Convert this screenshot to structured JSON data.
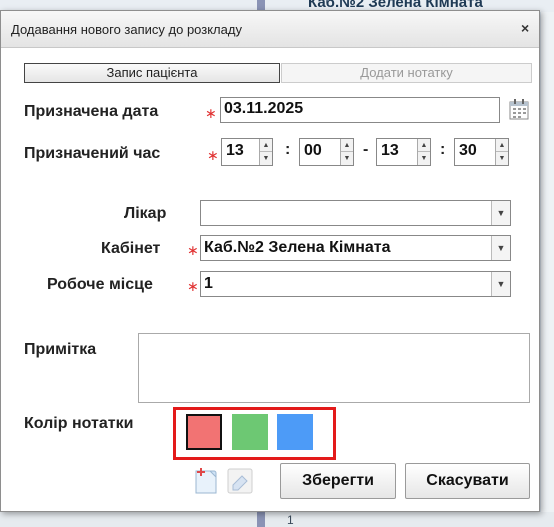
{
  "background": {
    "top_text": "Каб.№2 Зелена Кімната",
    "bottom_text": "1"
  },
  "dialog": {
    "title": "Додавання нового запису до розкладу",
    "close_label": "×"
  },
  "tabs": [
    {
      "label": "Запис пацієнта",
      "active": true
    },
    {
      "label": "Додати нотатку",
      "active": false
    }
  ],
  "form": {
    "date_label": "Призначена дата",
    "date_value": "03.11.2025",
    "time_label": "Призначений час",
    "time_start_hour": "13",
    "time_start_min": "00",
    "time_end_hour": "13",
    "time_end_min": "30",
    "time_colon": ":",
    "time_dash": "-",
    "required_mark": "∗",
    "doctor_label": "Лікар",
    "doctor_value": "",
    "cabinet_label": "Кабінет",
    "cabinet_value": "Каб.№2 Зелена Кімната",
    "workplace_label": "Робоче місце",
    "workplace_value": "1",
    "note_label": "Примітка",
    "note_value": "",
    "color_label": "Колір нотатки"
  },
  "swatches": [
    {
      "name": "red",
      "color": "#f27373",
      "selected": true
    },
    {
      "name": "green",
      "color": "#6dc873",
      "selected": false
    },
    {
      "name": "blue",
      "color": "#4d9bf7",
      "selected": false
    }
  ],
  "buttons": {
    "save": "Зберегти",
    "cancel": "Скасувати"
  },
  "icons": {
    "calendar": "calendar-icon",
    "dropdown": "chevron-down-icon",
    "spinner_up": "triangle-up",
    "spinner_down": "triangle-down",
    "add_document": "add-document-icon",
    "eraser": "eraser-icon"
  }
}
